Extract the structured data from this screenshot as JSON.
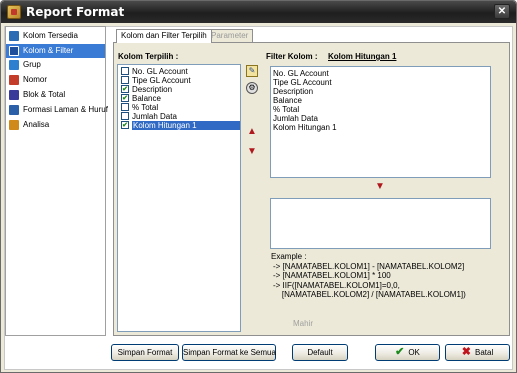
{
  "window": {
    "title": "Report Format",
    "close_symbol": "✕"
  },
  "nav": {
    "items": [
      {
        "label": "Kolom Tersedia",
        "icon": "table-icon",
        "color": "#2b6cb3"
      },
      {
        "label": "Kolom & Filter",
        "icon": "filter-grid-icon",
        "color": "#1f4f9b",
        "selected": true
      },
      {
        "label": "Grup",
        "icon": "group-icon",
        "color": "#2d7fd0"
      },
      {
        "label": "Nomor",
        "icon": "number-icon",
        "color": "#c43c2a"
      },
      {
        "label": "Blok & Total",
        "icon": "total-icon",
        "color": "#3a3a9a"
      },
      {
        "label": "Formasi Laman & Huruf",
        "icon": "page-format-icon",
        "color": "#2b5fa8"
      },
      {
        "label": "Analisa",
        "icon": "analysis-icon",
        "color": "#d08a1a"
      }
    ]
  },
  "tabs": [
    {
      "label": "Kolom dan Filter Terpilih",
      "active": true
    },
    {
      "label": "Parameter",
      "active": false
    }
  ],
  "selected_columns": {
    "label": "Kolom Terpilih :",
    "items": [
      {
        "label": "No. GL Account",
        "checked": false,
        "selected": false
      },
      {
        "label": "Tipe GL Account",
        "checked": false,
        "selected": false
      },
      {
        "label": "Description",
        "checked": true,
        "selected": false
      },
      {
        "label": "Balance",
        "checked": true,
        "selected": false
      },
      {
        "label": "% Total",
        "checked": false,
        "selected": false
      },
      {
        "label": "Jumlah Data",
        "checked": false,
        "selected": false
      },
      {
        "label": "Kolom Hitungan 1",
        "checked": true,
        "selected": true
      }
    ],
    "check_mark": "✔"
  },
  "tools": {
    "up_arrow": "▲",
    "down_arrow": "▼"
  },
  "filter": {
    "label": "Filter Kolom :",
    "current": "Kolom Hitungan 1",
    "items": [
      "No. GL Account",
      "Tipe GL Account",
      "Description",
      "Balance",
      "% Total",
      "Jumlah Data",
      "Kolom Hitungan 1"
    ],
    "down_arrow": "▼"
  },
  "example": {
    "title": "Example :",
    "lines": [
      "-> [NAMATABEL.KOLOM1] - [NAMATABEL.KOLOM2]",
      "-> [NAMATABEL.KOLOM1] * 100",
      "-> IIF([NAMATABEL.KOLOM1]=0,0,",
      "    [NAMATABEL.KOLOM2] / [NAMATABEL.KOLOM1])"
    ]
  },
  "mahir_label": "Mahir",
  "buttons": {
    "save_format": "Simpan Format",
    "save_format_all": "Simpan Format ke Semua",
    "default": "Default",
    "ok": "OK",
    "ok_icon": "✔",
    "cancel": "Batal",
    "cancel_icon": "✖"
  }
}
